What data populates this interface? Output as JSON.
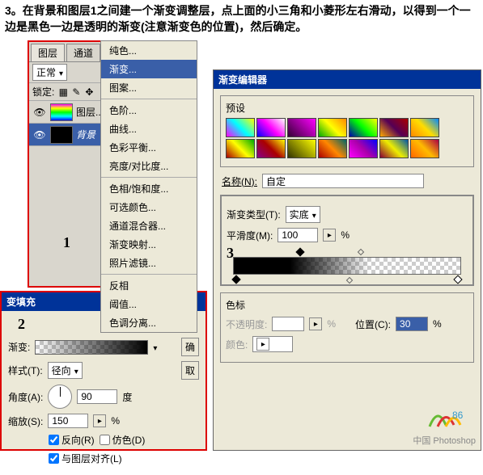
{
  "instruction": "3。在背景和图层1之间建一个渐变调整层，点上面的小三角和小菱形左右滑动，以得到一个一边是黑色一边是透明的渐变(注意渐变色的位置)，然后确定。",
  "layers_panel": {
    "tabs": {
      "layers": "图层",
      "channels": "通道"
    },
    "blend_label": "正常",
    "lock_label": "锁定:",
    "layer1_name": "图层...",
    "bg_name": "背景",
    "number": "1"
  },
  "menu": {
    "solid": "纯色...",
    "gradient": "渐变...",
    "pattern": "图案...",
    "levels": "色阶...",
    "curves": "曲线...",
    "color_balance": "色彩平衡...",
    "brightness": "亮度/对比度...",
    "hue": "色相/饱和度...",
    "selective": "可选颜色...",
    "channel_mixer": "通道混合器...",
    "gradient_map": "渐变映射...",
    "photo_filter": "照片滤镜...",
    "invert": "反相",
    "threshold": "阈值...",
    "posterize": "色调分离..."
  },
  "fill_dialog": {
    "title": "变填充",
    "number": "2",
    "gradient_label": "渐变:",
    "style_label": "样式(T):",
    "style_value": "径向",
    "angle_label": "角度(A):",
    "angle_value": "90",
    "degree": "度",
    "scale_label": "缩放(S):",
    "scale_value": "150",
    "percent": "%",
    "reverse": "反向(R)",
    "dither": "仿色(D)",
    "align": "与图层对齐(L)",
    "ok": "确",
    "cancel": "取"
  },
  "gradient_editor": {
    "title": "渐变编辑器",
    "preset_label": "预设",
    "name_label": "名称(N):",
    "name_value": "自定",
    "type_label": "渐变类型(T):",
    "type_value": "实底",
    "smooth_label": "平滑度(M):",
    "smooth_value": "100",
    "percent": "%",
    "number": "3",
    "stops_label": "色标",
    "opacity_label": "不透明度:",
    "color_label": "颜色:",
    "position_label": "位置(C):",
    "position_value": "30"
  },
  "logo": {
    "text": "中国 Photoshop",
    "num": "86"
  }
}
